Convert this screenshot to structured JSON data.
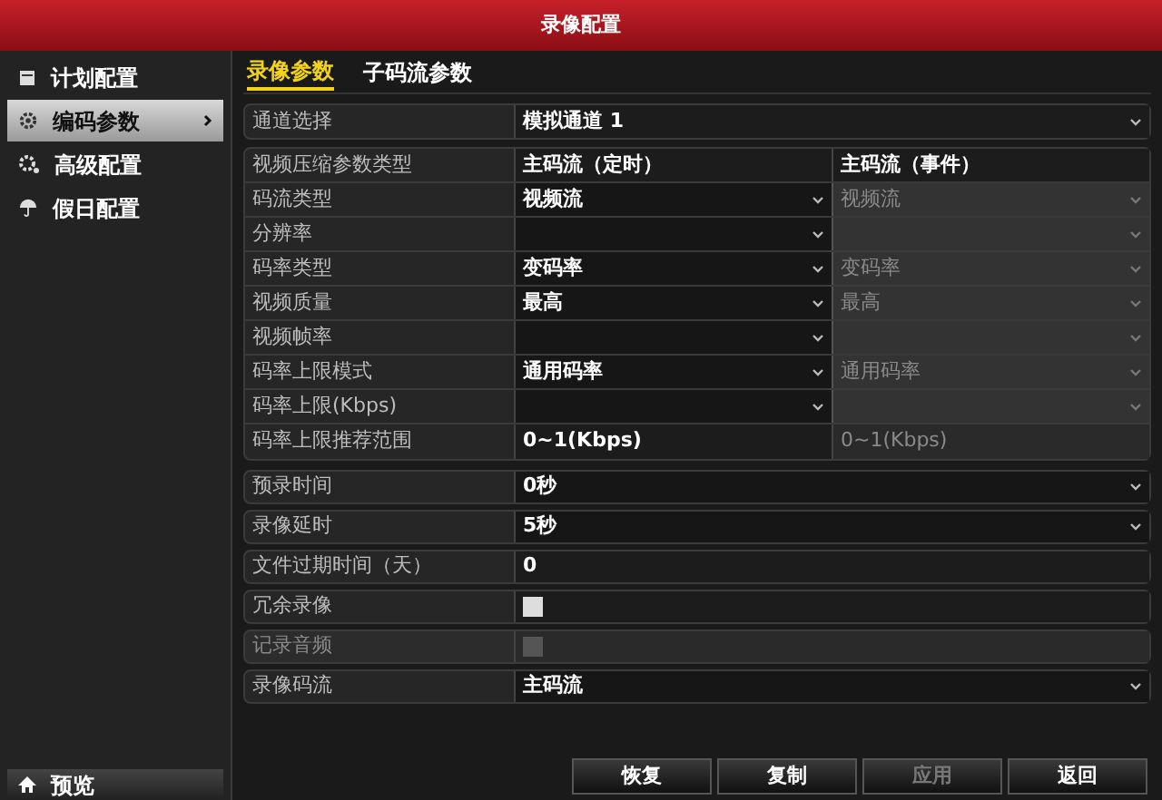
{
  "window": {
    "title": "录像配置"
  },
  "sidebar": {
    "items": [
      {
        "label": "计划配置",
        "selected": false
      },
      {
        "label": "编码参数",
        "selected": true
      },
      {
        "label": "高级配置",
        "selected": false
      },
      {
        "label": "假日配置",
        "selected": false
      }
    ],
    "footer": {
      "label": "预览"
    }
  },
  "tabs": [
    {
      "label": "录像参数",
      "selected": true
    },
    {
      "label": "子码流参数",
      "selected": false
    }
  ],
  "channel": {
    "label": "通道选择",
    "value": "模拟通道 1"
  },
  "table": {
    "header": {
      "label": "视频压缩参数类型",
      "columns": [
        "主码流（定时）",
        "主码流（事件）"
      ]
    },
    "rows": [
      {
        "label": "码流类型",
        "cells": [
          {
            "kind": "dropdown",
            "value": "视频流",
            "disabled": false
          },
          {
            "kind": "dropdown",
            "value": "视频流",
            "disabled": true
          }
        ]
      },
      {
        "label": "分辨率",
        "cells": [
          {
            "kind": "dropdown",
            "disabled": false
          },
          {
            "kind": "dropdown",
            "disabled": true
          }
        ]
      },
      {
        "label": "码率类型",
        "cells": [
          {
            "kind": "dropdown",
            "value": "变码率",
            "disabled": false
          },
          {
            "kind": "dropdown",
            "value": "变码率",
            "disabled": true
          }
        ]
      },
      {
        "label": "视频质量",
        "cells": [
          {
            "kind": "dropdown",
            "value": "最高",
            "disabled": false
          },
          {
            "kind": "dropdown",
            "value": "最高",
            "disabled": true
          }
        ]
      },
      {
        "label": "视频帧率",
        "cells": [
          {
            "kind": "dropdown",
            "disabled": false
          },
          {
            "kind": "dropdown",
            "disabled": true
          }
        ]
      },
      {
        "label": "码率上限模式",
        "cells": [
          {
            "kind": "dropdown",
            "value": "通用码率",
            "disabled": false
          },
          {
            "kind": "dropdown",
            "value": "通用码率",
            "disabled": true
          }
        ]
      },
      {
        "label": "码率上限(Kbps)",
        "cells": [
          {
            "kind": "dropdown",
            "disabled": false
          },
          {
            "kind": "dropdown",
            "disabled": true
          }
        ]
      },
      {
        "label": "码率上限推荐范围",
        "cells": [
          {
            "kind": "text",
            "value": "0~1(Kbps)",
            "disabled": false
          },
          {
            "kind": "text",
            "value": "0~1(Kbps)",
            "disabled": true
          }
        ]
      }
    ]
  },
  "settings": [
    {
      "label": "预录时间",
      "kind": "dropdown",
      "value": "0秒",
      "disabled": false
    },
    {
      "label": "录像延时",
      "kind": "dropdown",
      "value": "5秒",
      "disabled": false
    },
    {
      "label": "文件过期时间（天）",
      "kind": "text",
      "value": "0",
      "disabled": false
    },
    {
      "label": "冗余录像",
      "kind": "checkbox",
      "checked": false,
      "disabled": false
    },
    {
      "label": "记录音频",
      "kind": "checkbox",
      "checked": false,
      "disabled": true
    },
    {
      "label": "录像码流",
      "kind": "dropdown",
      "value": "主码流",
      "disabled": false
    }
  ],
  "buttons": [
    {
      "label": "恢复",
      "disabled": false
    },
    {
      "label": "复制",
      "disabled": false
    },
    {
      "label": "应用",
      "disabled": true
    },
    {
      "label": "返回",
      "disabled": false
    }
  ]
}
